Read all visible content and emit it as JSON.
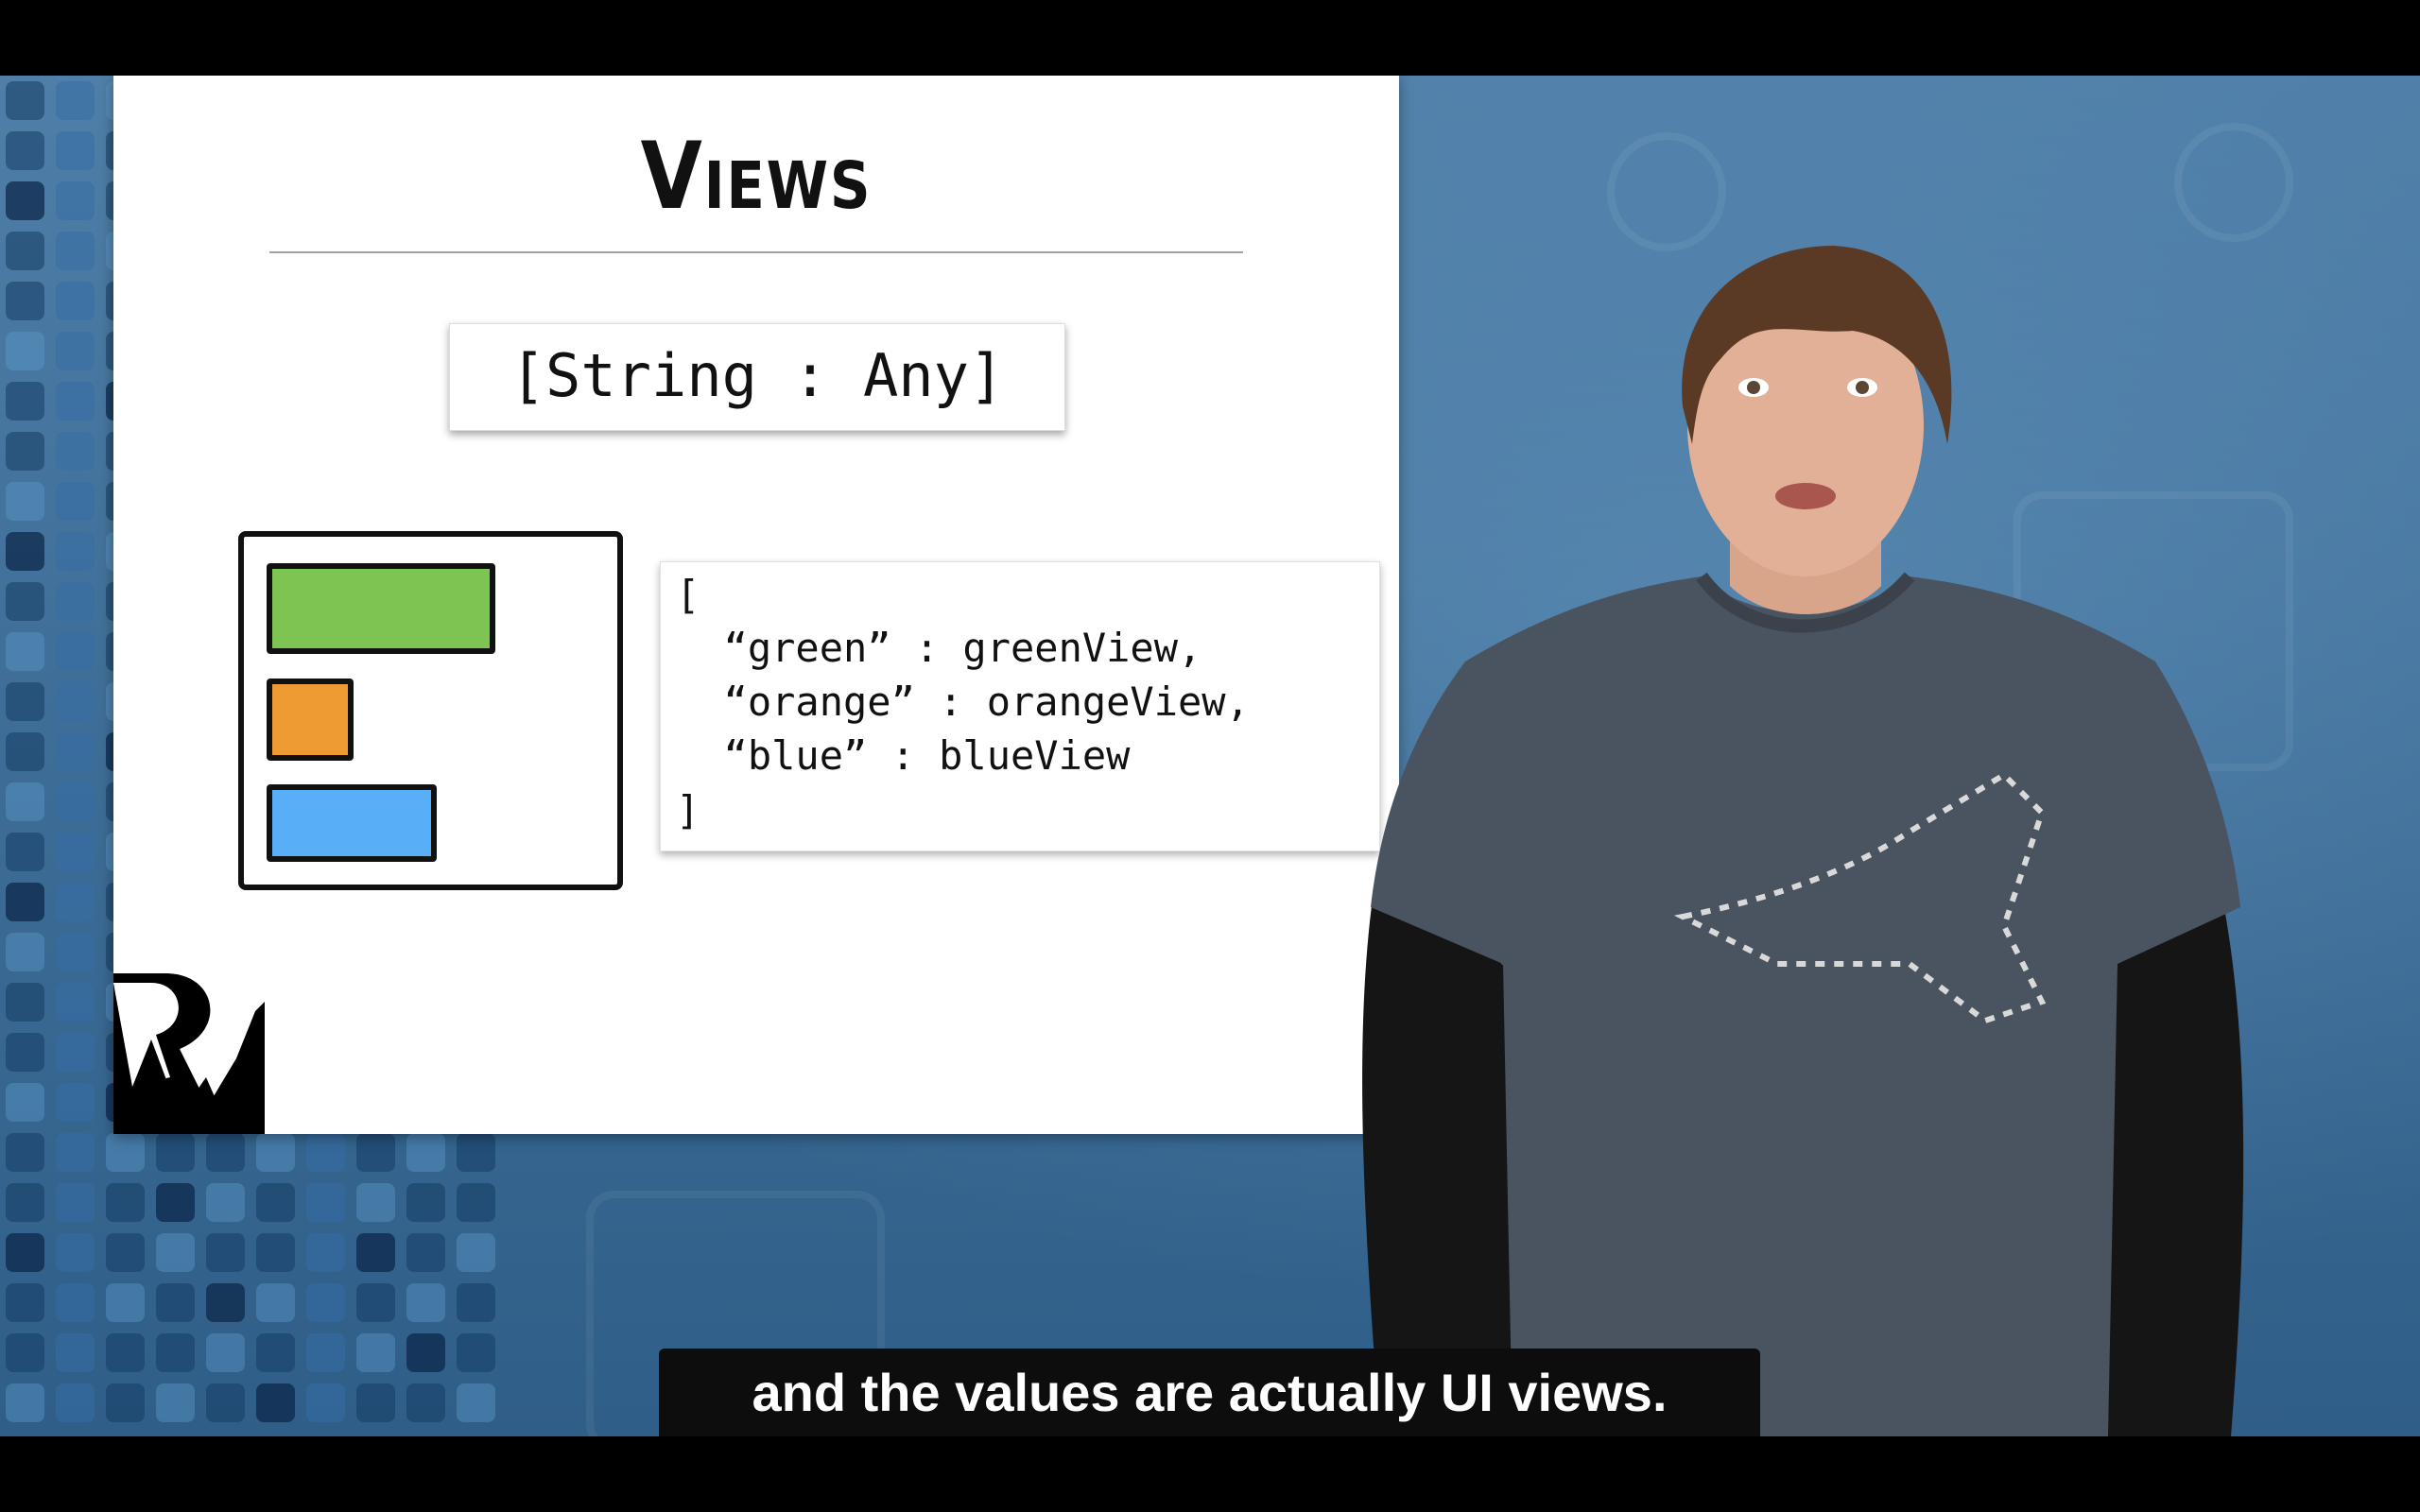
{
  "slide": {
    "title": "Views",
    "type_signature": "[String : Any]",
    "code_lines": [
      "[",
      "  “green” : greenView,",
      "  “orange” : orangeView,",
      "  “blue” : blueView",
      "]"
    ],
    "bar_colors": {
      "green": "#7dc452",
      "orange": "#ef9b33",
      "blue": "#58aef7"
    }
  },
  "logo": {
    "name": "raywenderlich-logo"
  },
  "caption": {
    "text": "and the values are actually UI views."
  },
  "colors": {
    "background_blue": "#3f6f98",
    "caption_bg": "#0d0d0d"
  }
}
